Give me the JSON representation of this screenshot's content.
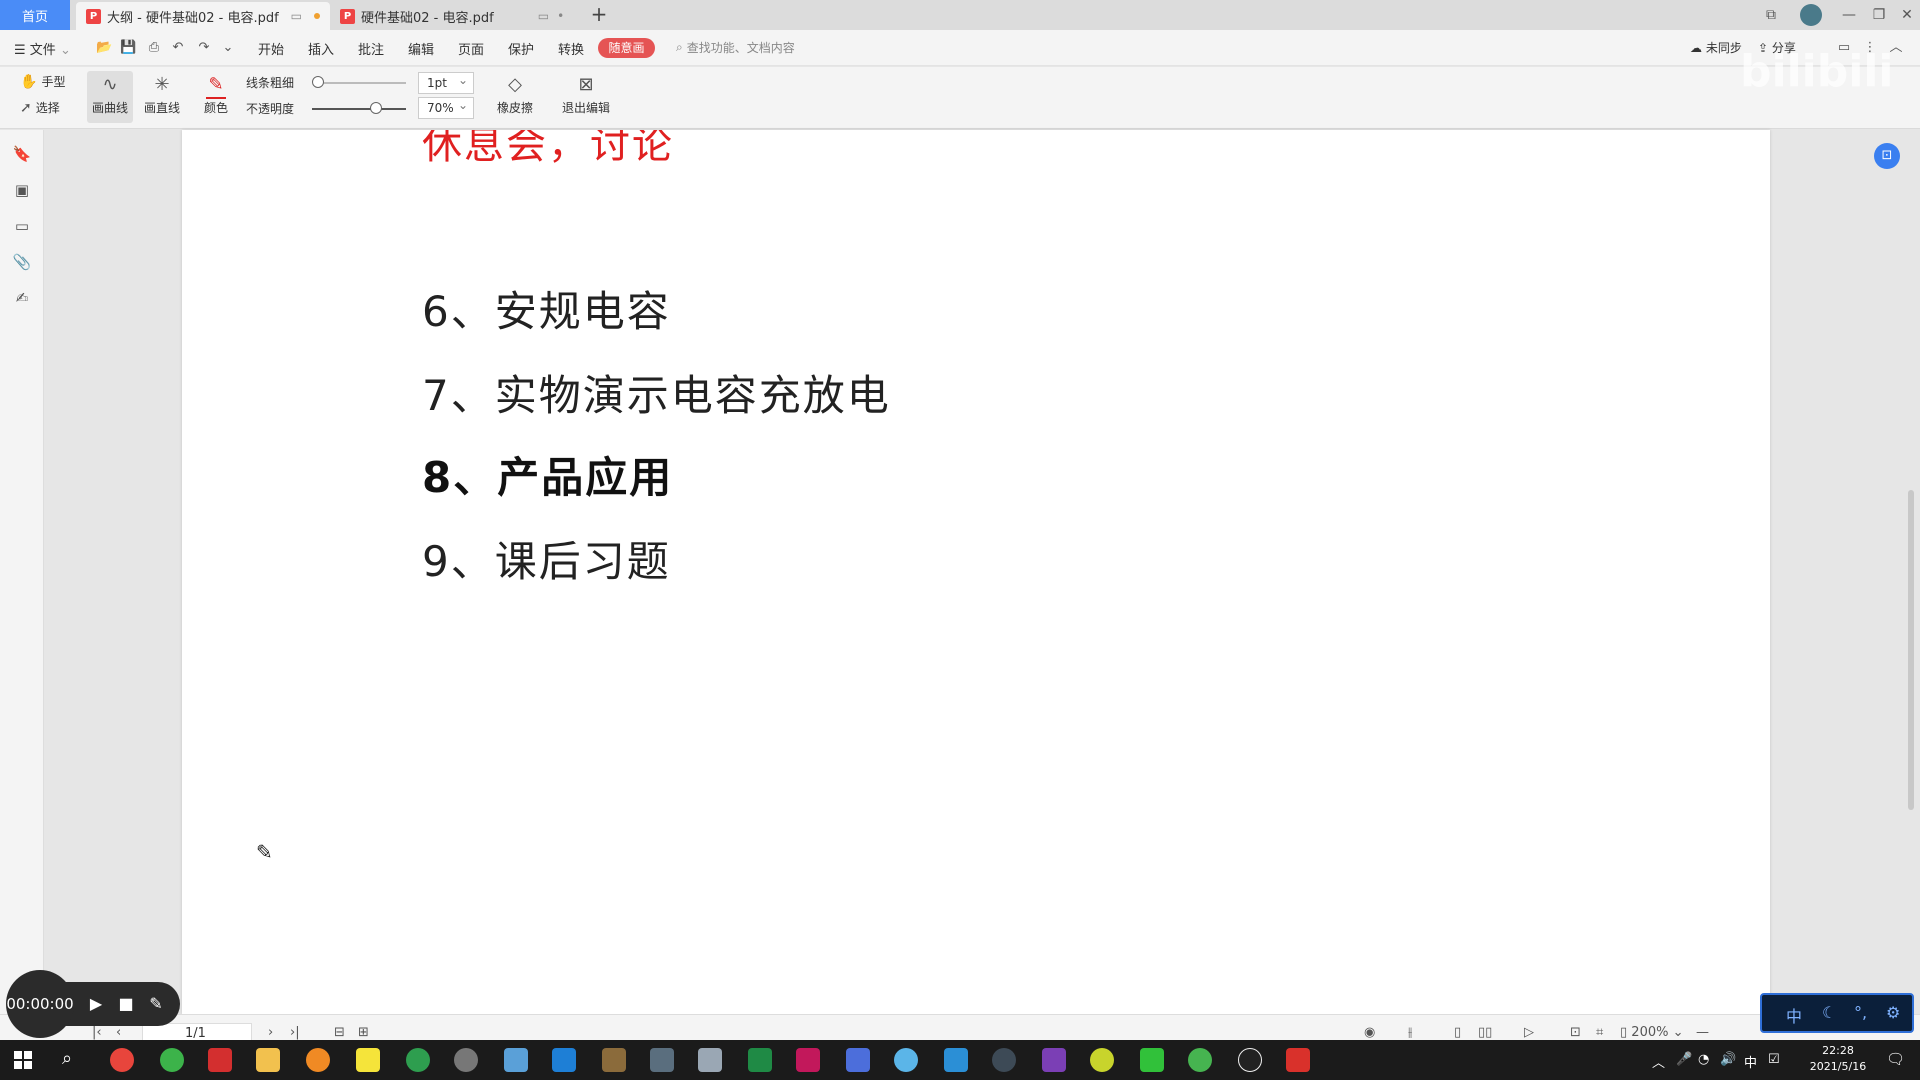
{
  "tabs": {
    "home": "首页",
    "items": [
      {
        "label": "大纲 - 硬件基础02 - 电容.pdf",
        "badge": "P"
      },
      {
        "label": "硬件基础02 - 电容.pdf",
        "badge": "P"
      }
    ],
    "add": "+"
  },
  "menu": {
    "file": "文件",
    "items": [
      "开始",
      "插入",
      "批注",
      "编辑",
      "页面",
      "保护",
      "转换"
    ],
    "highlight": "随意画",
    "search_placeholder": "查找功能、文档内容",
    "sync": "未同步",
    "share": "分享"
  },
  "toolbar": {
    "hand": "手型",
    "select": "选择",
    "draw_curve": "画曲线",
    "draw_line": "画直线",
    "color": "颜色",
    "line_width_label": "线条粗细",
    "opacity_label": "不透明度",
    "line_width_value": "1pt",
    "opacity_value": "70%",
    "eraser": "橡皮擦",
    "exit_edit": "退出编辑"
  },
  "document": {
    "heading_partial": "休息会，讨论",
    "lines": [
      {
        "text": "6、安规电容",
        "bold": false
      },
      {
        "text": "7、实物演示电容充放电",
        "bold": false
      },
      {
        "text": "8、产品应用",
        "bold": true
      },
      {
        "text": "9、课后习题",
        "bold": false
      }
    ]
  },
  "statusbar": {
    "page": "1/1",
    "zoom": "200%"
  },
  "recorder": {
    "time": "00:00:00"
  },
  "ime": {
    "lang": "中"
  },
  "taskbar": {
    "clock_time": "22:28",
    "clock_date": "2021/5/16",
    "tray_lang": "中"
  },
  "colors": {
    "accent": "#4a8cf7",
    "highlight_pill": "#e55454",
    "heading_red": "#e02020"
  }
}
